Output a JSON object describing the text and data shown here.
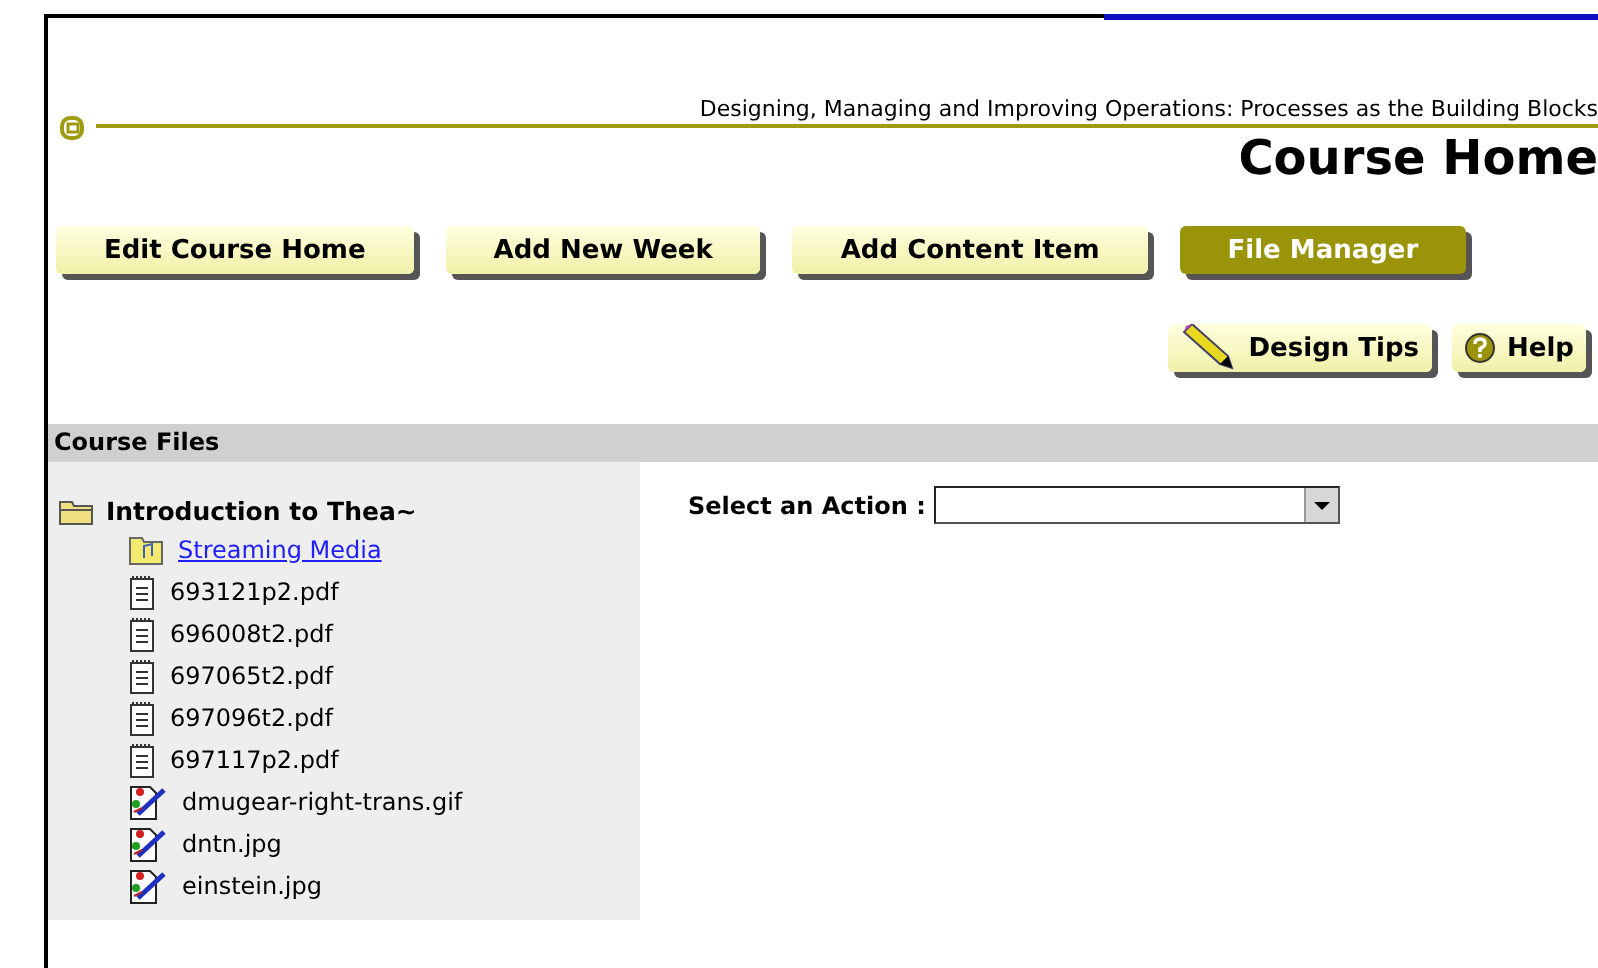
{
  "header": {
    "course_title": "Designing, Managing and Improving Operations: Processes as the Building Blocks",
    "page_title": "Course Home"
  },
  "nav_buttons": [
    {
      "label": "Edit Course Home",
      "selected": false
    },
    {
      "label": "Add New Week",
      "selected": false
    },
    {
      "label": "Add Content Item",
      "selected": false
    },
    {
      "label": "File Manager",
      "selected": true
    }
  ],
  "tools": [
    {
      "label": "Design Tips",
      "kind": "tips"
    },
    {
      "label": "Help",
      "kind": "help"
    }
  ],
  "files_panel": {
    "title": "Course Files",
    "root": {
      "label": "Introduction to Thea~",
      "kind": "folder",
      "children": [
        {
          "label": "Streaming Media",
          "kind": "media"
        },
        {
          "label": "693121p2.pdf",
          "kind": "pdf"
        },
        {
          "label": "696008t2.pdf",
          "kind": "pdf"
        },
        {
          "label": "697065t2.pdf",
          "kind": "pdf"
        },
        {
          "label": "697096t2.pdf",
          "kind": "pdf"
        },
        {
          "label": "697117p2.pdf",
          "kind": "pdf"
        },
        {
          "label": "dmugear-right-trans.gif",
          "kind": "image"
        },
        {
          "label": "dntn.jpg",
          "kind": "image"
        },
        {
          "label": "einstein.jpg",
          "kind": "image"
        }
      ]
    }
  },
  "action": {
    "label": "Select an Action :"
  }
}
